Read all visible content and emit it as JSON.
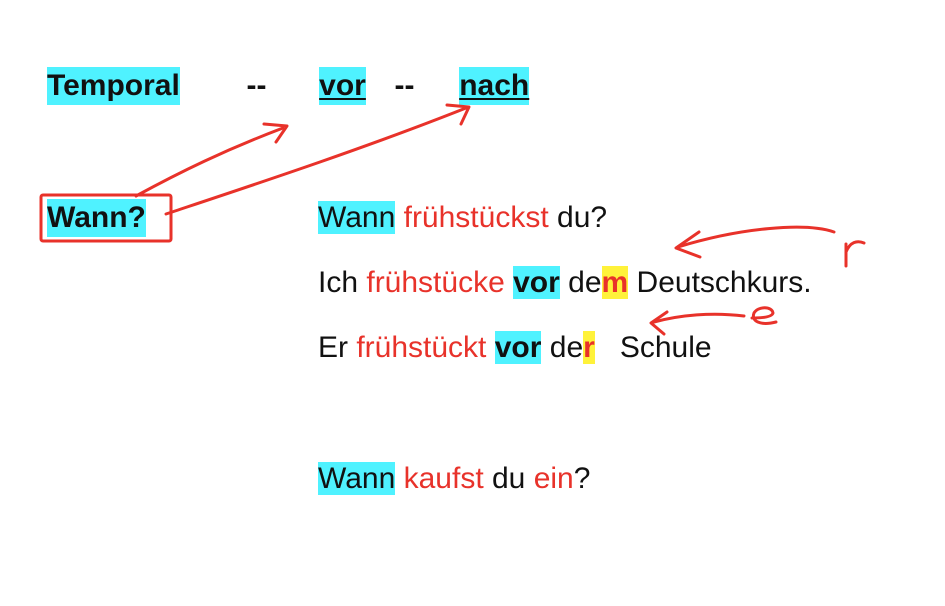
{
  "header": {
    "temporal": "Temporal",
    "dash1": "--",
    "vor": "vor",
    "dash2": "--",
    "nach": "nach"
  },
  "question_label": "Wann?",
  "sentences": [
    {
      "parts": [
        "Wann",
        " ",
        "frühstückst",
        " du?"
      ]
    },
    {
      "parts": [
        "Ich ",
        "frühstücke",
        " ",
        "vor",
        " de",
        "m",
        " Deutschkurs."
      ]
    },
    {
      "parts": [
        "Er ",
        "frühstückt",
        " ",
        "vor",
        " de",
        "r",
        "   Schule"
      ]
    },
    {
      "parts": [
        "Wann",
        " ",
        "kaufst",
        " du ",
        "ein",
        "?"
      ]
    }
  ],
  "annotations": {
    "letter_r": "r",
    "letter_e": "e"
  },
  "colors": {
    "highlight_cyan": "#4ff2ff",
    "highlight_yellow": "#fff23a",
    "ink_red": "#e8322a"
  }
}
